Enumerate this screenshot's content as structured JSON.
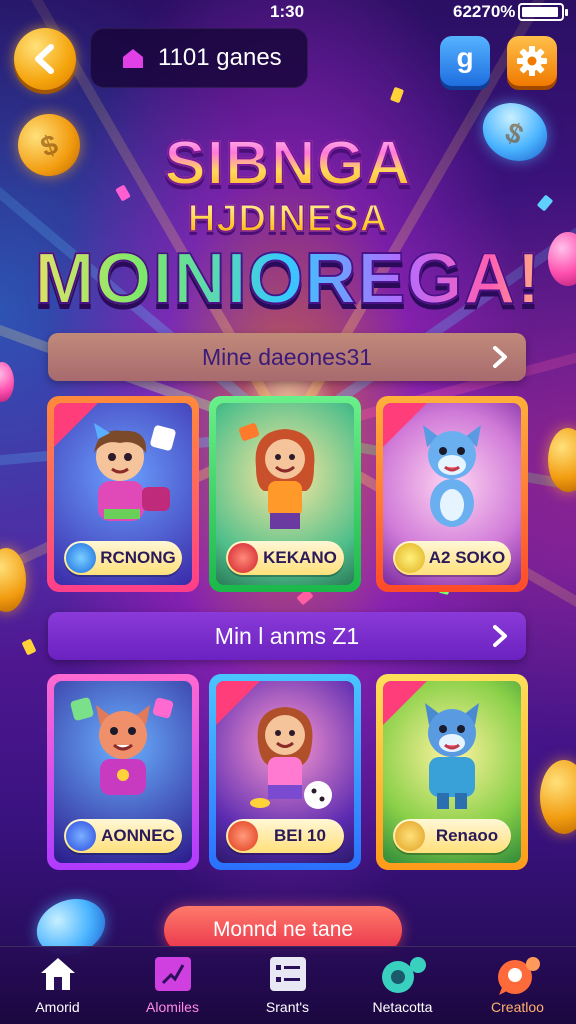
{
  "status_bar": {
    "time": "1:30",
    "battery": "62270%"
  },
  "header": {
    "counter_label": "1101 ganes",
    "g_label": "g"
  },
  "title": {
    "line1": "SIBNGA",
    "line2": "HJDINESA",
    "line3": "MOINIOREGA!"
  },
  "sections": [
    {
      "label": "Mine daeones31"
    },
    {
      "label": "Min l anms Z1"
    }
  ],
  "cards_row1": [
    {
      "name": "RCNONG"
    },
    {
      "name": "KEKANO"
    },
    {
      "name": "A2 SOKO"
    }
  ],
  "cards_row2": [
    {
      "name": "AONNEC"
    },
    {
      "name": "BEI    10"
    },
    {
      "name": "Renaoo"
    }
  ],
  "cta": {
    "label": "Monnd ne tane"
  },
  "bottom_nav": [
    {
      "label": "Amorid"
    },
    {
      "label": "Alomiles"
    },
    {
      "label": "Srant's"
    },
    {
      "label": "Netacotta"
    },
    {
      "label": "Creatloo"
    }
  ],
  "colors": {
    "accent_orange": "#f5a40c",
    "purple_bg": "#4a1690",
    "cta_red": "#e8324a"
  }
}
